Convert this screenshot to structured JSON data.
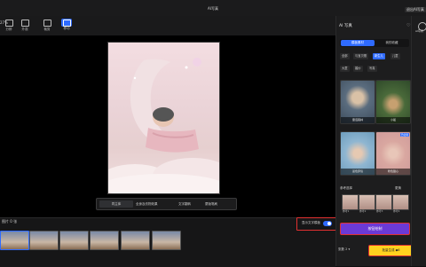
{
  "window": {
    "title": "AI写真",
    "back_label": "退出AI写真"
  },
  "toolbar": {
    "zoom": "27%",
    "tools": [
      {
        "name": "tool-1",
        "label": "分辨"
      },
      {
        "name": "tool-2",
        "label": "外观"
      },
      {
        "name": "tool-3",
        "label": "裁剪"
      },
      {
        "name": "tool-4",
        "label": "移动"
      }
    ]
  },
  "canvas": {
    "modes": [
      "同主体",
      "全身及衣物效果",
      "文字翻转",
      "蒙版笔刷"
    ]
  },
  "filmstrip": {
    "label": "图片 0 张",
    "toggle_label": "显示文字模板",
    "toggle_on": true
  },
  "panel": {
    "title": "AI 写真",
    "tabs": [
      "模板素材",
      "我的收藏"
    ],
    "chips": [
      "全部",
      "与宝贝照",
      "新生儿",
      "儿童",
      "大童",
      "婚纱",
      "写真"
    ],
    "cards": [
      {
        "caption": "童话森林"
      },
      {
        "caption": "小船"
      },
      {
        "caption": "蓝色梦境"
      },
      {
        "caption": "粉色甜心",
        "badge": "已使用"
      }
    ],
    "reference": {
      "title": "参考选择",
      "change": "更换"
    },
    "refs": [
      "参考1",
      "参考2",
      "参考3",
      "参考4"
    ],
    "generate_label": "按钮绘制",
    "footer_left": "张数 2 ▾",
    "go_label": "批量生成 ◆6"
  },
  "rail": {
    "label": "AI写真"
  }
}
